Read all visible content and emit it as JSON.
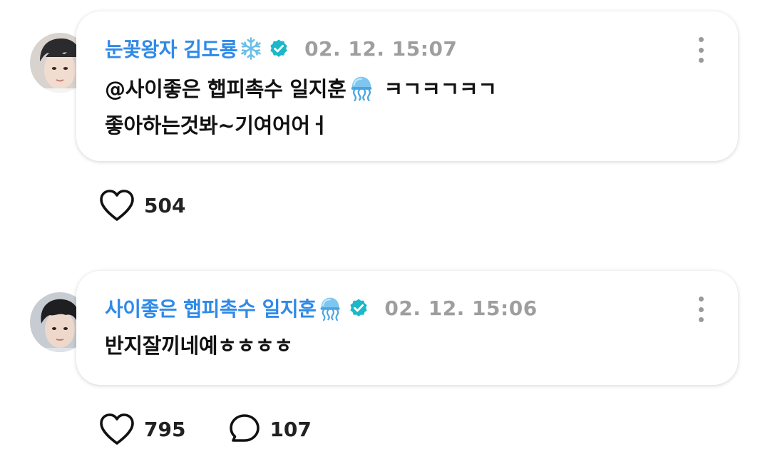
{
  "posts": [
    {
      "author": "눈꽃왕자 김도룡",
      "author_emoji": "snowflake-icon",
      "verified": true,
      "timestamp": "02. 12. 15:07",
      "content_lines": [
        "@사이좋은 햅피촉수 일지훈",
        "좋아하는것봐~기여어어ㅓ"
      ],
      "mention_emoji": "jellyfish-icon",
      "mention_suffix": "ㅋㄱㅋㄱㅋㄱ",
      "likes": "504"
    },
    {
      "author": "사이좋은 햅피촉수 일지훈",
      "author_emoji": "jellyfish-icon",
      "verified": true,
      "timestamp": "02. 12. 15:06",
      "content_lines": [
        "반지잘끼네예ㅎㅎㅎㅎ"
      ],
      "likes": "795",
      "comments": "107"
    }
  ],
  "colors": {
    "author": "#2f8ae8",
    "verified_badge": "#1ab8c8",
    "timestamp": "#9e9e9e",
    "text": "#111111"
  }
}
